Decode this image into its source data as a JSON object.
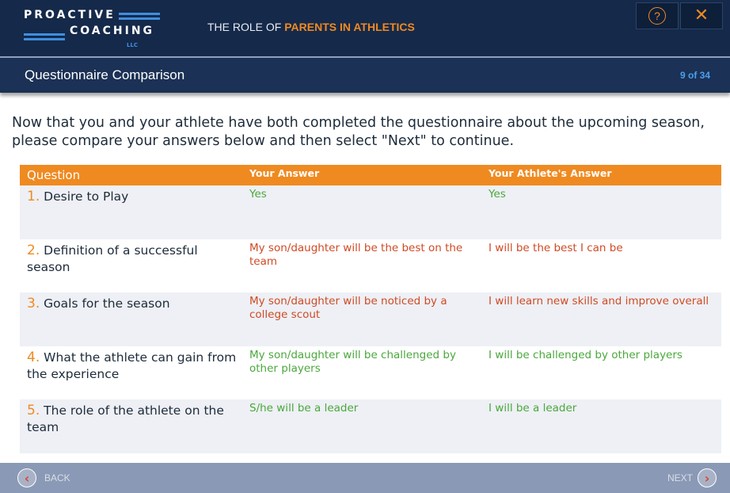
{
  "header": {
    "logo_line1": "PROACTIVE",
    "logo_line2": "COACHING",
    "logo_llc": "LLC",
    "course_title_prefix": "THE ROLE OF ",
    "course_title_highlight": "PARENTS IN ATHLETICS",
    "help_glyph": "?",
    "close_glyph": "✕"
  },
  "subheader": {
    "title": "Questionnaire Comparison",
    "counter": "9 of 34"
  },
  "intro": "Now that you and your athlete have both completed the questionnaire about the upcoming season, please compare your answers below and then select \"Next\" to continue.",
  "table": {
    "headers": {
      "question": "Question",
      "your_answer": "Your Answer",
      "athlete_answer": "Your Athlete's Answer"
    },
    "rows": [
      {
        "num": "1.",
        "question": "Desire to Play",
        "your_answer": "Yes",
        "athlete_answer": "Yes",
        "match": true
      },
      {
        "num": "2.",
        "question": "Definition of a successful season",
        "your_answer": "My son/daughter will be the best on the team",
        "athlete_answer": "I will be the best I can be",
        "match": false
      },
      {
        "num": "3.",
        "question": "Goals for the season",
        "your_answer": "My son/daughter will be noticed by a college scout",
        "athlete_answer": "I will learn new skills and improve overall",
        "match": false
      },
      {
        "num": "4.",
        "question": "What the athlete can gain from the experience",
        "your_answer": "My son/daughter will be challenged by other players",
        "athlete_answer": "I will be challenged by other players",
        "match": true
      },
      {
        "num": "5.",
        "question": "The role of the athlete on the team",
        "your_answer": "S/he will be a leader",
        "athlete_answer": "I will be a leader",
        "match": true
      }
    ]
  },
  "footer": {
    "back_label": "BACK",
    "next_label": "NEXT"
  },
  "colors": {
    "accent": "#ef8a21",
    "header_bg": "#15294a",
    "match": "#4aa83c",
    "mismatch": "#d04a24"
  }
}
